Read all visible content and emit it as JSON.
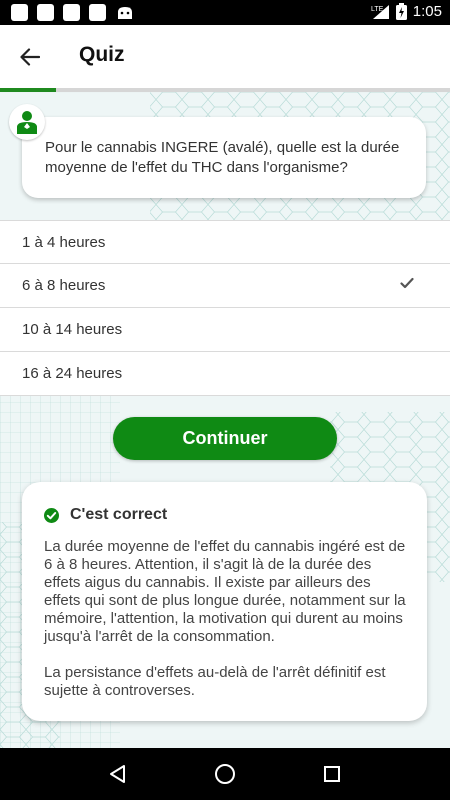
{
  "status_bar": {
    "network": "LTE",
    "time": "1:05",
    "icons": [
      "notification-icon",
      "notification-icon",
      "notification-icon",
      "notification-icon",
      "android-icon",
      "signal-icon",
      "battery-charging-icon"
    ]
  },
  "header": {
    "title": "Quiz",
    "back_icon": "arrow-back-icon"
  },
  "progress": {
    "fraction": 0.125,
    "color": "#1f8a1f"
  },
  "question": {
    "avatar_icon": "person-icon",
    "text": "Pour le cannabis INGERE (avalé), quelle est la durée moyenne de l'effet du THC dans l'organisme?"
  },
  "answers": [
    {
      "label": "1 à 4 heures",
      "selected": false
    },
    {
      "label": "6 à 8 heures",
      "selected": true
    },
    {
      "label": "10 à 14 heures",
      "selected": false
    },
    {
      "label": "16 à 24 heures",
      "selected": false
    }
  ],
  "continue_label": "Continuer",
  "feedback": {
    "icon": "check-circle-icon",
    "title": "C'est correct",
    "paragraph1": "La durée moyenne de l'effet du cannabis ingéré est de 6 à 8 heures. Attention, il s'agit là de la durée des effets aigus du cannabis. Il existe par ailleurs des effets qui sont de plus longue durée, notamment sur la mémoire, l'attention, la motivation qui durent au moins jusqu'à l'arrêt de la consommation.",
    "paragraph2": "La persistance d'effets au-delà de l'arrêt définitif est sujette à controverses."
  },
  "nav": {
    "back": "nav-back-icon",
    "home": "nav-home-icon",
    "recents": "nav-recents-icon"
  },
  "colors": {
    "accent": "#0f8a14",
    "pattern_bg": "#eef6f6",
    "pattern_line": "#a9d3cf"
  }
}
